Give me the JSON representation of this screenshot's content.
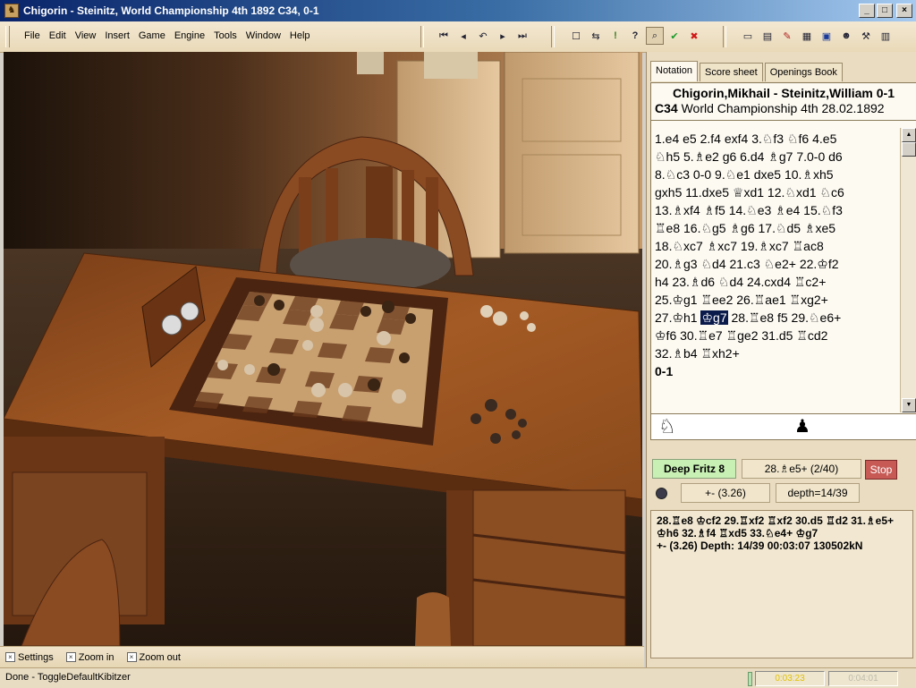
{
  "window": {
    "title": "Chigorin - Steinitz, World Championship 4th 1892  C34, 0-1",
    "app_icon": "fritz-app-icon",
    "controls": {
      "minimize": "_",
      "maximize": "□",
      "close": "×"
    }
  },
  "menu": {
    "items": [
      "File",
      "Edit",
      "View",
      "Insert",
      "Game",
      "Engine",
      "Tools",
      "Window",
      "Help"
    ]
  },
  "toolbar": {
    "nav_icons": [
      "first-move-icon",
      "previous-move-icon",
      "take-back-icon",
      "next-move-icon",
      "last-move-icon"
    ],
    "nav_glyphs": [
      "⏮",
      "◂",
      "↶",
      "▸",
      "⏭"
    ],
    "action_icons": [
      "new-game-icon",
      "flip-board-icon",
      "hint-icon",
      "coach-icon",
      "analysis-icon",
      "accept-icon",
      "cancel-icon"
    ],
    "action_glyphs": [
      "☐",
      "⇆",
      "!",
      "?",
      "⌕",
      "✔",
      "✖"
    ],
    "tool_icons": [
      "eraser-icon",
      "book-icon",
      "pen-icon",
      "board-icon",
      "monitor-icon",
      "person-icon",
      "tools-icon",
      "database-icon"
    ],
    "tool_glyphs": [
      "▭",
      "▤",
      "✎",
      "▦",
      "▣",
      "☻",
      "⚒",
      "▥"
    ]
  },
  "view_bar": {
    "items": [
      {
        "label": "Settings"
      },
      {
        "label": "Zoom in"
      },
      {
        "label": "Zoom out"
      }
    ]
  },
  "status": {
    "message": "Done - ToggleDefaultKibitzer",
    "clock_white": "0:03:23",
    "clock_black": "0:04:01"
  },
  "notation_panel": {
    "tabs": [
      "Notation",
      "Score sheet",
      "Openings Book"
    ],
    "active_tab": "Notation",
    "players": "Chigorin,Mikhail - Steinitz,William  0-1",
    "eco": "C34",
    "event": "World Championship 4th 28.02.1892",
    "move_lines": [
      [
        "1.e4  e5  2.f4  exf4  3.♘f3  ♘f6  4.e5"
      ],
      [
        "♘h5  5.♗e2  g6  6.d4  ♗g7  7.0-0  d6"
      ],
      [
        "8.♘c3  0-0  9.♘e1  dxe5  10.♗xh5"
      ],
      [
        "gxh5  11.dxe5  ♕xd1  12.♘xd1  ♘c6"
      ],
      [
        "13.♗xf4  ♗f5  14.♘e3  ♗e4  15.♘f3"
      ],
      [
        "♖e8  16.♘g5  ♗g6  17.♘d5  ♗xe5"
      ],
      [
        "18.♘xc7  ♗xc7  19.♗xc7  ♖ac8"
      ],
      [
        "20.♗g3  ♘d4  21.c3  ♘e2+  22.♔f2"
      ],
      [
        "h4  23.♗d6  ♘d4  24.cxd4  ♖c2+"
      ],
      [
        "25.♔g1  ♖ee2  26.♖ae1  ♖xg2+"
      ],
      [
        "27.♔h1 ",
        "♔g7",
        "  28.♖e8  f5  29.♘e6+"
      ],
      [
        "♔f6  30.♖e7  ♖ge2  31.d5  ♖cd2"
      ],
      [
        "32.♗b4  ♖xh2+"
      ]
    ],
    "result": "0-1",
    "sidebar_icons": [
      "white-knight-icon",
      "black-pawn-icon"
    ],
    "sidebar_glyphs": [
      "♘",
      "♟"
    ]
  },
  "engine": {
    "name": "Deep Fritz 8",
    "best_move": "28.♗e5+ (2/40)",
    "stop_label": "Stop",
    "evaluation": "+-  (3.26)",
    "depth": "depth=14/39",
    "output_lines": [
      "28.♖e8 ♔cf2 29.♖xf2 ♖xf2 30.d5 ♖d2 31.♗e5+",
      "♔h6 32.♗f4 ♖xd5 33.♘e4+ ♔g7",
      "+-  (3.26)   Depth: 14/39   00:03:07   130502kN"
    ]
  },
  "board_view": {
    "scene": "3D chess room with wooden table, chair, chess clock and board"
  }
}
